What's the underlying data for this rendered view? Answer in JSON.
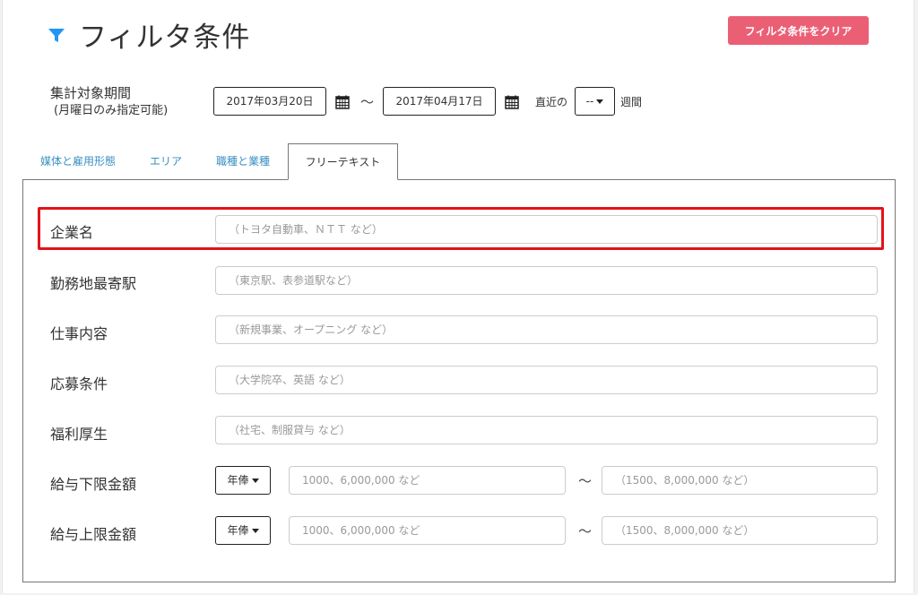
{
  "header": {
    "title": "フィルタ条件",
    "clear_button": "フィルタ条件をクリア",
    "accent_color": "#2196f3",
    "clear_color": "#eb5f75"
  },
  "period": {
    "label": "集計対象期間",
    "sublabel": "(月曜日のみ指定可能)",
    "start_date": "2017年03月20日",
    "end_date": "2017年04月17日",
    "separator": "〜",
    "recent_label": "直近の",
    "weeks_value": "--",
    "weeks_suffix": "週間"
  },
  "tabs": [
    {
      "label": "媒体と雇用形態",
      "active": false
    },
    {
      "label": "エリア",
      "active": false
    },
    {
      "label": "職種と業種",
      "active": false
    },
    {
      "label": "フリーテキスト",
      "active": true
    }
  ],
  "fields": {
    "company": {
      "label": "企業名",
      "placeholder": "（トヨタ自動車、ＮＴＴ など）"
    },
    "station": {
      "label": "勤務地最寄駅",
      "placeholder": "（東京駅、表参道駅など）"
    },
    "job": {
      "label": "仕事内容",
      "placeholder": "（新規事業、オープニング など）"
    },
    "conditions": {
      "label": "応募条件",
      "placeholder": "（大学院卒、英語 など）"
    },
    "welfare": {
      "label": "福利厚生",
      "placeholder": "（社宅、制服貸与 など）"
    },
    "salary_min": {
      "label": "給与下限金額",
      "unit": "年俸",
      "from_placeholder": "1000、6,000,000 など",
      "separator": "〜",
      "to_placeholder": "（1500、8,000,000 など）"
    },
    "salary_max": {
      "label": "給与上限金額",
      "unit": "年俸",
      "from_placeholder": "1000、6,000,000 など",
      "separator": "〜",
      "to_placeholder": "（1500、8,000,000 など）"
    }
  }
}
